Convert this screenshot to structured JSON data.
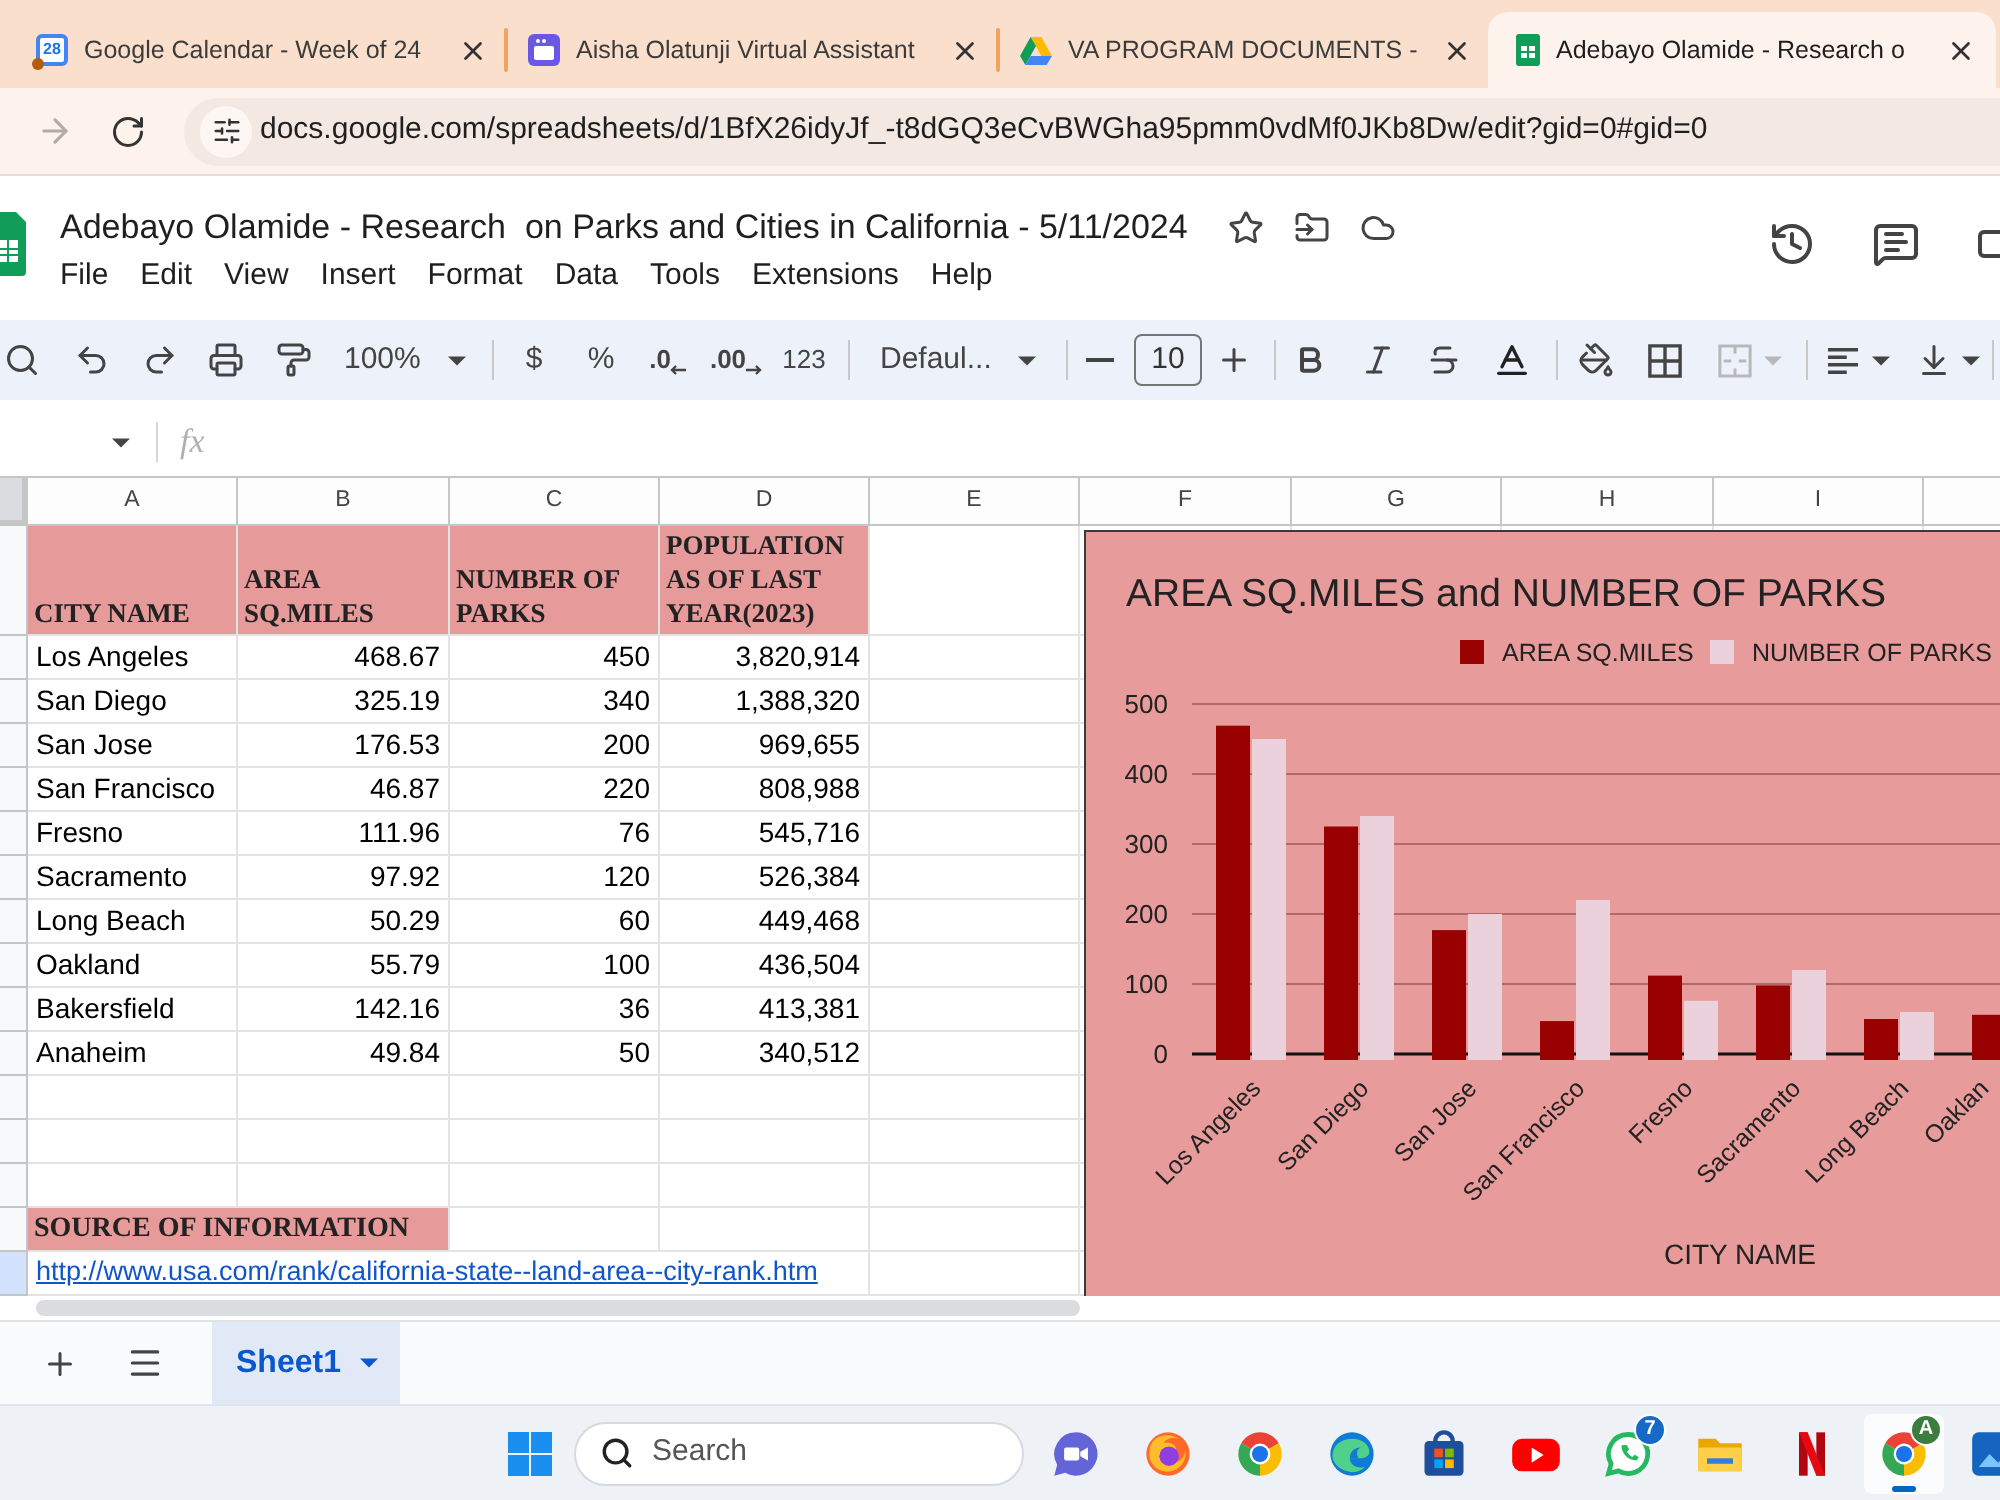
{
  "browser": {
    "tabs": [
      {
        "kind": "calendar",
        "icon_text": "28",
        "title": "Google Calendar - Week of 24",
        "selected": false
      },
      {
        "kind": "app",
        "title": "Aisha Olatunji Virtual Assistant",
        "selected": false
      },
      {
        "kind": "drive",
        "title": "VA PROGRAM DOCUMENTS -",
        "selected": false
      },
      {
        "kind": "sheets",
        "title": "Adebayo Olamide - Research o",
        "selected": true
      }
    ],
    "forward_button": {
      "disabled": true
    },
    "url": "docs.google.com/spreadsheets/d/1BfX26idyJf_-t8dGQ3eCvBWGha95pmm0vdMf0JKb8Dw/edit?gid=0#gid=0"
  },
  "docs": {
    "title": "Adebayo Olamide - Research  on Parks and Cities in California - 5/11/2024",
    "menu": [
      "File",
      "Edit",
      "View",
      "Insert",
      "Format",
      "Data",
      "Tools",
      "Extensions",
      "Help"
    ]
  },
  "toolbar": {
    "zoom": "100%",
    "currency": "$",
    "percent": "%",
    "decrease_decimal": ".0",
    "increase_decimal": ".00",
    "number_format": "123",
    "font": "Defaul...",
    "font_size": "10",
    "merge_cells": {
      "disabled": true
    }
  },
  "formula_bar": {
    "label": "fx"
  },
  "sheet": {
    "columns": [
      "A",
      "B",
      "C",
      "D",
      "E",
      "F",
      "G",
      "H",
      "I"
    ],
    "rows": [
      {
        "kind": "header",
        "cells": [
          "CITY NAME",
          "AREA SQ.MILES",
          "NUMBER OF PARKS",
          "POPULATION AS OF LAST YEAR(2023)"
        ],
        "selected": false
      },
      {
        "kind": "data",
        "cells": [
          "Los Angeles",
          "468.67",
          "450",
          "3,820,914"
        ],
        "selected": false
      },
      {
        "kind": "data",
        "cells": [
          "San Diego",
          "325.19",
          "340",
          "1,388,320"
        ],
        "selected": false
      },
      {
        "kind": "data",
        "cells": [
          "San Jose",
          "176.53",
          "200",
          "969,655"
        ],
        "selected": false
      },
      {
        "kind": "data",
        "cells": [
          "San Francisco",
          "46.87",
          "220",
          "808,988"
        ],
        "selected": false
      },
      {
        "kind": "data",
        "cells": [
          "Fresno",
          "111.96",
          "76",
          "545,716"
        ],
        "selected": false
      },
      {
        "kind": "data",
        "cells": [
          "Sacramento",
          "97.92",
          "120",
          "526,384"
        ],
        "selected": false
      },
      {
        "kind": "data",
        "cells": [
          "Long Beach",
          "50.29",
          "60",
          "449,468"
        ],
        "selected": false
      },
      {
        "kind": "data",
        "cells": [
          "Oakland",
          "55.79",
          "100",
          "436,504"
        ],
        "selected": false
      },
      {
        "kind": "data",
        "cells": [
          "Bakersfield",
          "142.16",
          "36",
          "413,381"
        ],
        "selected": false
      },
      {
        "kind": "data",
        "cells": [
          "Anaheim",
          "49.84",
          "50",
          "340,512"
        ],
        "selected": false
      },
      {
        "kind": "empty",
        "selected": false
      },
      {
        "kind": "empty",
        "selected": false
      },
      {
        "kind": "empty",
        "selected": false
      },
      {
        "kind": "source",
        "text": "SOURCE OF INFORMATION",
        "selected": false
      },
      {
        "kind": "link",
        "text": "http://www.usa.com/rank/california-state--land-area--city-rank.htm",
        "selected": true
      }
    ]
  },
  "chart": {
    "chart_data": {
      "type": "bar",
      "title": "AREA SQ.MILES and NUMBER OF PARKS",
      "xlabel": "CITY NAME",
      "categories": [
        "Los Angeles",
        "San Diego",
        "San Jose",
        "San Francisco",
        "Fresno",
        "Sacramento",
        "Long Beach",
        "Oaklan"
      ],
      "series": [
        {
          "name": "AREA SQ.MILES",
          "color": "#990000",
          "values": [
            469,
            325,
            177,
            47,
            112,
            98,
            50,
            56
          ]
        },
        {
          "name": "NUMBER OF PARKS",
          "color": "#ead1dc",
          "values": [
            450,
            340,
            200,
            220,
            76,
            120,
            60,
            null
          ]
        }
      ],
      "ylim": [
        0,
        500
      ],
      "yticks": [
        {
          "value": 0,
          "label": "0"
        },
        {
          "value": 100,
          "label": "100"
        },
        {
          "value": 200,
          "label": "200"
        },
        {
          "value": 300,
          "label": "300"
        },
        {
          "value": 400,
          "label": "400"
        },
        {
          "value": 500,
          "label": "500"
        }
      ],
      "grid": true,
      "legend": "top"
    }
  },
  "sheet_tabs": [
    {
      "label": "Sheet1",
      "selected": true
    }
  ],
  "taskbar": {
    "search": {
      "placeholder": "Search"
    },
    "apps": [
      {
        "kind": "meet",
        "selected": false
      },
      {
        "kind": "firefox",
        "selected": false
      },
      {
        "kind": "chrome",
        "selected": false
      },
      {
        "kind": "edge",
        "selected": false
      },
      {
        "kind": "store",
        "selected": false
      },
      {
        "kind": "youtube",
        "selected": false
      },
      {
        "kind": "whatsapp",
        "badge": {
          "text": "7",
          "color": "#1769c7"
        },
        "selected": false
      },
      {
        "kind": "files",
        "selected": false
      },
      {
        "kind": "netflix",
        "selected": false
      },
      {
        "kind": "chrome",
        "badge": {
          "text": "A",
          "color": "#3b7d3e"
        },
        "selected": true
      },
      {
        "kind": "app",
        "selected": false
      }
    ]
  }
}
